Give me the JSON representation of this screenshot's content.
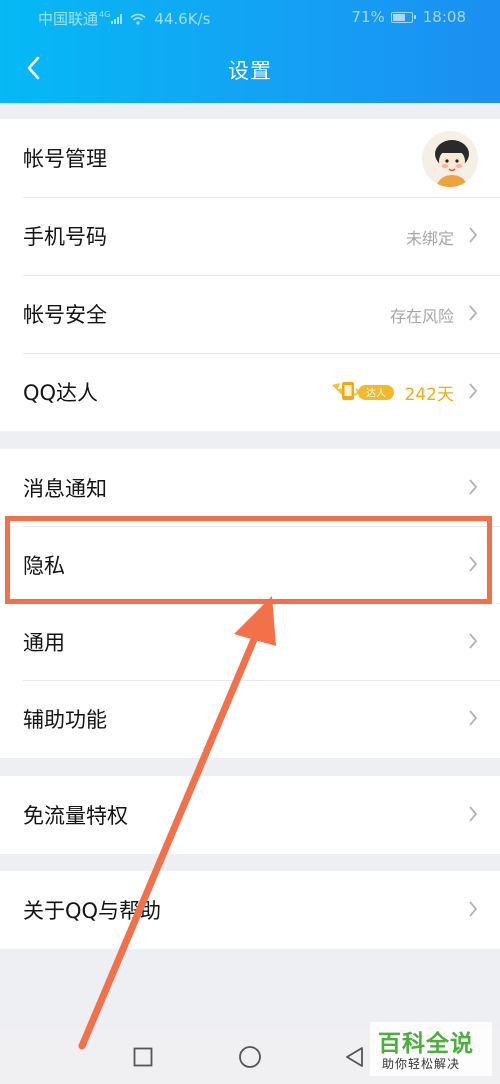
{
  "status_bar": {
    "carrier": "中国联通",
    "network": "4G",
    "speed": "44.6K/s",
    "battery": "71%",
    "time": "18:08"
  },
  "header": {
    "title": "设置",
    "back_icon": "chevron-left-icon"
  },
  "groups": [
    {
      "items": [
        {
          "label": "帐号管理",
          "value": "",
          "accessory": "avatar"
        },
        {
          "label": "手机号码",
          "value": "未绑定"
        },
        {
          "label": "帐号安全",
          "value": "存在风险"
        },
        {
          "label": "QQ达人",
          "badge": "达人",
          "value": "242天"
        }
      ]
    },
    {
      "items": [
        {
          "label": "消息通知",
          "value": ""
        },
        {
          "label": "隐私",
          "value": "",
          "highlighted": true
        },
        {
          "label": "通用",
          "value": ""
        },
        {
          "label": "辅助功能",
          "value": ""
        }
      ]
    },
    {
      "items": [
        {
          "label": "免流量特权",
          "value": ""
        }
      ]
    },
    {
      "items": [
        {
          "label": "关于QQ与帮助",
          "value": ""
        }
      ]
    }
  ],
  "nav_bar": {
    "recent_icon": "square-icon",
    "home_icon": "circle-icon",
    "back_icon": "triangle-back-icon"
  },
  "watermark": {
    "title": "百科全说",
    "subtitle": "助你轻松解决"
  },
  "colors": {
    "header_start": "#05b9f5",
    "header_end": "#1b8ff2",
    "highlight": "#f2704a",
    "talent": "#f0ad14",
    "watermark_green": "#4cae3f"
  }
}
